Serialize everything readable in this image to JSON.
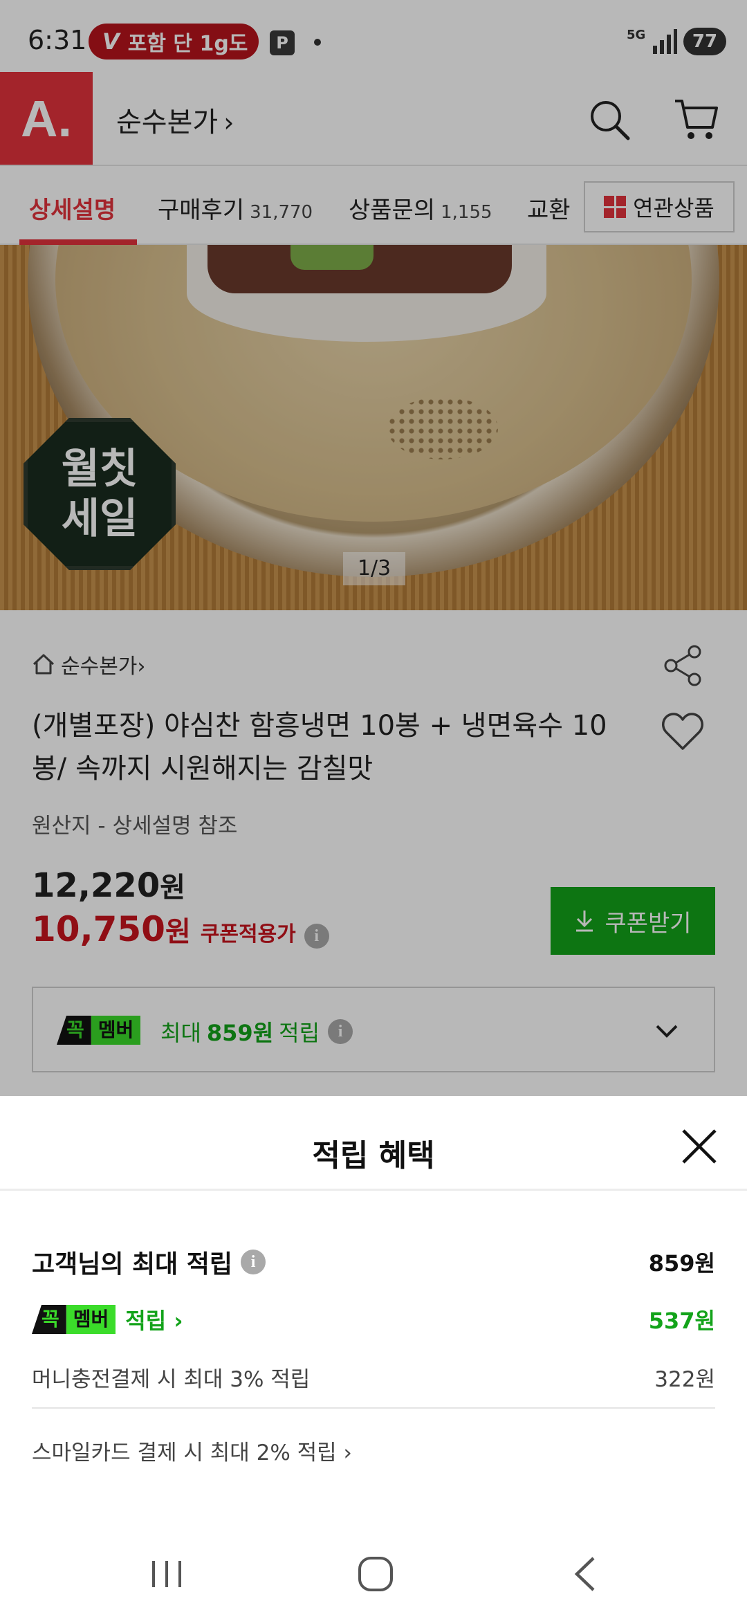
{
  "status_bar": {
    "time": "6:31",
    "promo_text": "포함 단 1g도",
    "p_label": "P",
    "network": "5G",
    "battery": "77"
  },
  "header": {
    "logo": "A.",
    "store_name": "순수본가",
    "store_chevron": "›"
  },
  "tabs": {
    "items": [
      {
        "label": "상세설명",
        "count": ""
      },
      {
        "label": "구매후기",
        "count": "31,770"
      },
      {
        "label": "상품문의",
        "count": "1,155"
      },
      {
        "label": "교환",
        "count": ""
      }
    ],
    "related_label": "연관상품"
  },
  "product_image": {
    "badge_text": "월칫\n세일",
    "counter": "1/3"
  },
  "product": {
    "breadcrumb": "순수본가›",
    "title": "(개별포장) 야심찬 함흥냉면 10봉 + 냉면육수 10봉/  속까지 시원해지는 감칠맛",
    "origin": "원산지 - 상세설명 참조",
    "price_original": "12,220",
    "price_sale": "10,750",
    "currency": "원",
    "coupon_price_label": "쿠폰적용가",
    "coupon_button": "쿠폰받기",
    "member": {
      "badge_a": "꼭",
      "badge_b": "멤버",
      "prefix": "최대",
      "amount": "859원",
      "suffix": "적립"
    }
  },
  "sheet": {
    "title": "적립 혜택",
    "max_label": "고객님의 최대 적립",
    "max_amount": "859원",
    "member_badge_a": "꼭",
    "member_badge_b": "멤버",
    "member_label": "적립 ›",
    "member_amount": "537원",
    "money_label": "머니충전결제 시 최대 3% 적립",
    "money_amount": "322원",
    "smile_label": "스마일카드 결제 시 최대 2% 적립 ›"
  },
  "icons": {
    "info": "i"
  },
  "colors": {
    "brand_red": "#e2333c",
    "sale_red": "#c8141e",
    "green": "#13a31a",
    "member_green": "#3bdc2a"
  }
}
